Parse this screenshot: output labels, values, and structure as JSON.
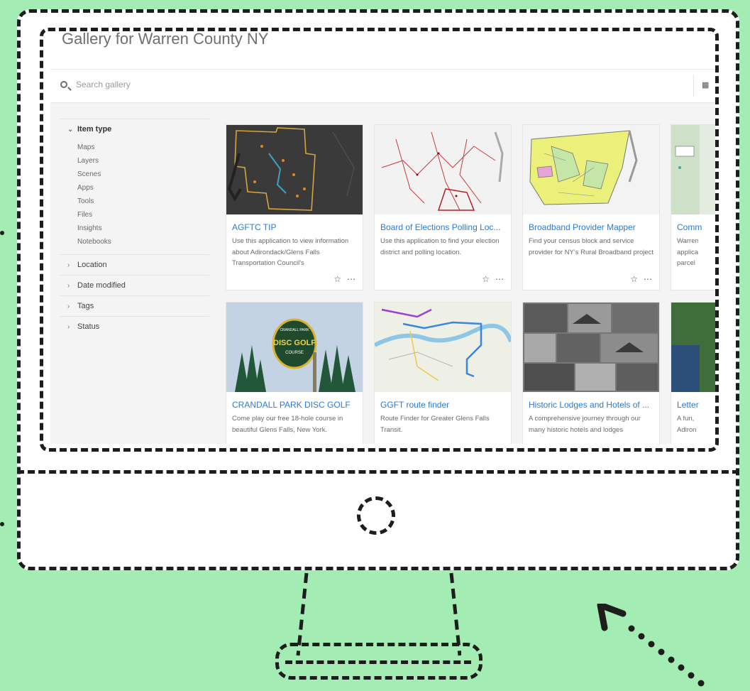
{
  "gallery": {
    "title": "Gallery for Warren County NY",
    "search_placeholder": "Search gallery",
    "grid_icon": "grid-icon"
  },
  "filters": {
    "item_type": {
      "label": "Item type",
      "options": [
        "Maps",
        "Layers",
        "Scenes",
        "Apps",
        "Tools",
        "Files",
        "Insights",
        "Notebooks"
      ]
    },
    "collapsed": [
      "Location",
      "Date modified",
      "Tags",
      "Status"
    ]
  },
  "cards": [
    {
      "title": "AGFTC TIP",
      "desc": "Use this application to view information about Adirondack/Glens Falls Transportation Council's"
    },
    {
      "title": "Board of Elections Polling Loc...",
      "desc": "Use this application to find your election district and polling location."
    },
    {
      "title": "Broadband Provider Mapper",
      "desc": "Find your census block and service provider for NY's Rural Broadband project"
    },
    {
      "title": "Comm",
      "desc": "Warren applica parcel"
    },
    {
      "title": "CRANDALL PARK DISC GOLF",
      "desc": "Come play our free 18-hole course in beautiful Glens Falls, New York."
    },
    {
      "title": "GGFT route finder",
      "desc": "Route Finder for Greater Glens Falls Transit."
    },
    {
      "title": "Historic Lodges and Hotels of ...",
      "desc": "A comprehensive journey through our many historic hotels and lodges"
    },
    {
      "title": "Letter",
      "desc": "A fun, Adiron"
    }
  ],
  "disc_golf_logo": {
    "top": "CRANDALL PARK",
    "main": "DISC GOLF",
    "sub": "COURSE"
  },
  "icons": {
    "star": "☆",
    "more": "⋯"
  },
  "colors": {
    "background": "#a3ecb3",
    "link": "#2b7bd3"
  }
}
